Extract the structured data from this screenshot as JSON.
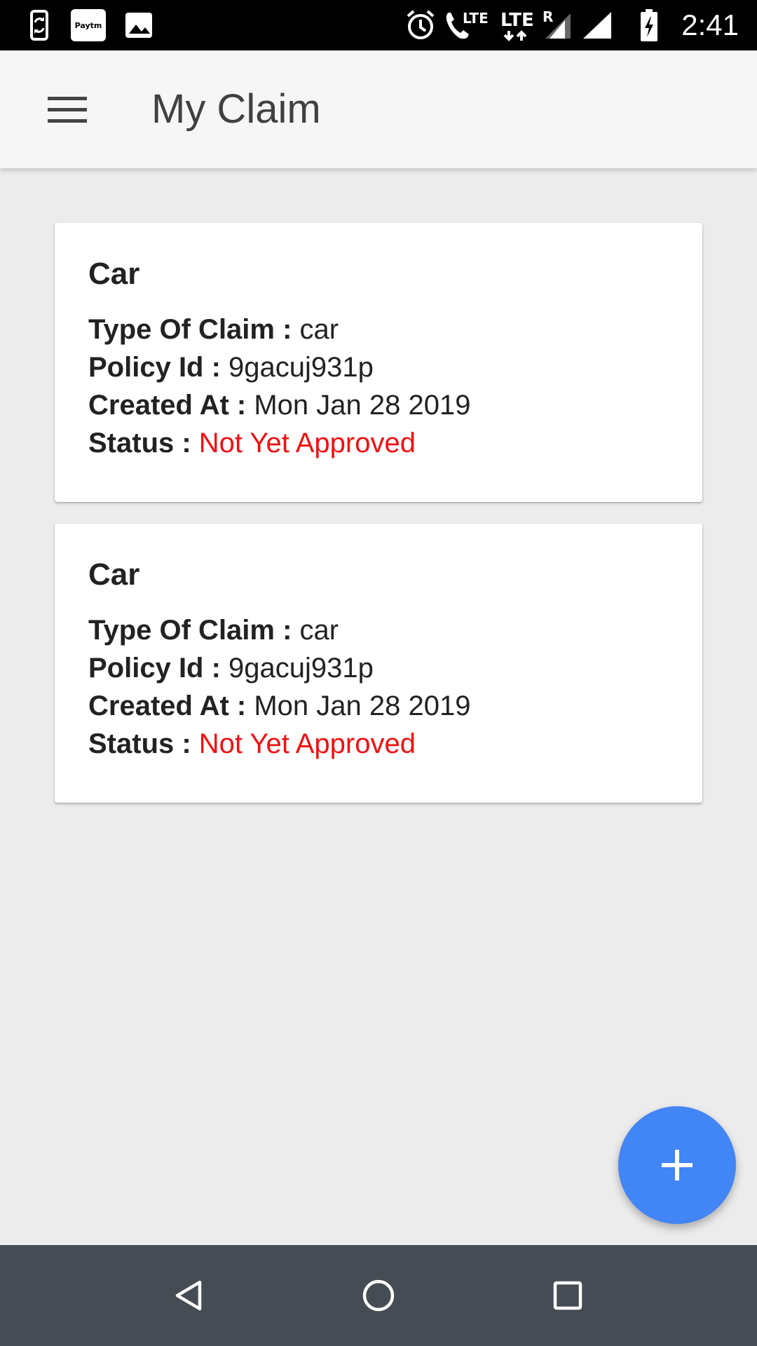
{
  "status_bar": {
    "time": "2:41",
    "paytm_label": "Paytm",
    "lte1": "LTE",
    "lte2": "LTE",
    "roaming": "R",
    "icons": [
      "screen-rotate-icon",
      "paytm-icon",
      "image-icon",
      "alarm-icon",
      "call-icon",
      "signal-icon",
      "battery-charging-icon"
    ]
  },
  "app_bar": {
    "title": "My Claim"
  },
  "claims": [
    {
      "title": "Car",
      "type_label": "Type Of Claim : ",
      "type_value": "car",
      "policy_label": "Policy Id : ",
      "policy_value": "9gacuj931p",
      "created_label": "Created At : ",
      "created_value": "Mon Jan 28 2019",
      "status_label": "Status : ",
      "status_value": "Not Yet Approved"
    },
    {
      "title": "Car",
      "type_label": "Type Of Claim : ",
      "type_value": "car",
      "policy_label": "Policy Id : ",
      "policy_value": "9gacuj931p",
      "created_label": "Created At : ",
      "created_value": "Mon Jan 28 2019",
      "status_label": "Status : ",
      "status_value": "Not Yet Approved"
    }
  ],
  "colors": {
    "status_red": "#ee1111",
    "fab_blue": "#4285f4",
    "nav_bar": "#454c53"
  },
  "fab": {
    "icon": "plus-icon"
  },
  "nav": {
    "icons": [
      "back-icon",
      "home-icon",
      "recents-icon"
    ]
  }
}
